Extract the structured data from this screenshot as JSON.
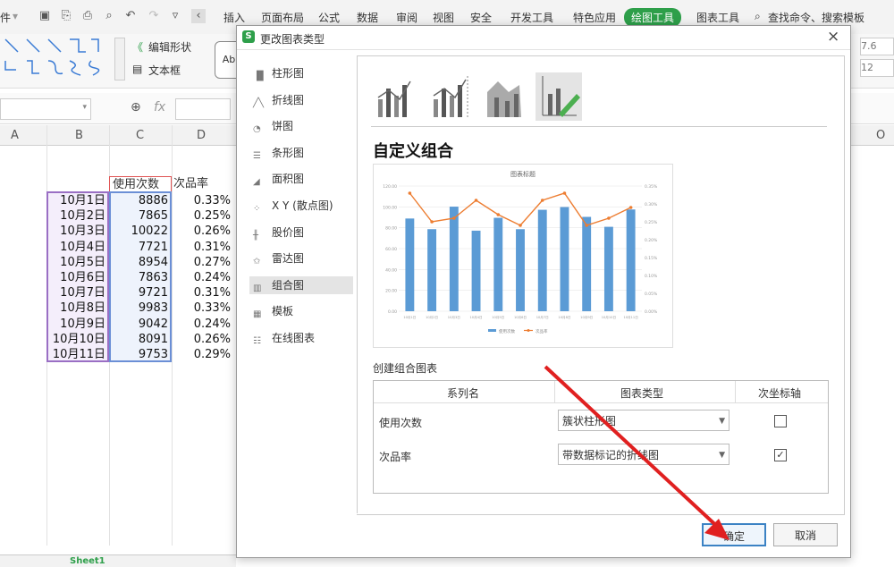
{
  "menu": {
    "file_partial": "件",
    "tabs": [
      "插入",
      "页面布局",
      "公式",
      "数据",
      "审阅",
      "视图",
      "安全",
      "开发工具",
      "特色应用"
    ],
    "active_tab": "绘图工具",
    "chart_tool_tab": "图表工具",
    "search_text": "查找命令、搜索模板"
  },
  "ribbon": {
    "edit_shape": "编辑形状",
    "text_box": "文本框",
    "style_preview": "Ab",
    "right_values": [
      "7.6",
      "12"
    ]
  },
  "formula": {
    "fx": "fx"
  },
  "sheet": {
    "columns": [
      "A",
      "B",
      "C",
      "D",
      "O"
    ],
    "header_c": "使用次数",
    "header_d": "次品率",
    "rows": [
      {
        "date": "10月1日",
        "count": "8886",
        "rate": "0.33%"
      },
      {
        "date": "10月2日",
        "count": "7865",
        "rate": "0.25%"
      },
      {
        "date": "10月3日",
        "count": "10022",
        "rate": "0.26%"
      },
      {
        "date": "10月4日",
        "count": "7721",
        "rate": "0.31%"
      },
      {
        "date": "10月5日",
        "count": "8954",
        "rate": "0.27%"
      },
      {
        "date": "10月6日",
        "count": "7863",
        "rate": "0.24%"
      },
      {
        "date": "10月7日",
        "count": "9721",
        "rate": "0.31%"
      },
      {
        "date": "10月8日",
        "count": "9983",
        "rate": "0.33%"
      },
      {
        "date": "10月9日",
        "count": "9042",
        "rate": "0.24%"
      },
      {
        "date": "10月10日",
        "count": "8091",
        "rate": "0.26%"
      },
      {
        "date": "10月11日",
        "count": "9753",
        "rate": "0.29%"
      }
    ],
    "sheet_tab": "Sheet1"
  },
  "dialog": {
    "title": "更改图表类型",
    "close": "×",
    "types": [
      "柱形图",
      "折线图",
      "饼图",
      "条形图",
      "面积图",
      "X Y (散点图)",
      "股价图",
      "雷达图",
      "组合图",
      "模板",
      "在线图表"
    ],
    "selected_type": "组合图",
    "heading": "自定义组合",
    "create_label": "创建组合图表",
    "col_series": "系列名",
    "col_type": "图表类型",
    "col_secondary": "次坐标轴",
    "rows": [
      {
        "series": "使用次数",
        "type": "簇状柱形图",
        "secondary": false
      },
      {
        "series": "次品率",
        "type": "带数据标记的折线图",
        "secondary": true
      }
    ],
    "ok": "确定",
    "cancel": "取消"
  },
  "chart_data": {
    "type": "bar",
    "title": "图表标题",
    "categories": [
      "10月1日",
      "10月2日",
      "10月3日",
      "10月4日",
      "10月5日",
      "10月6日",
      "10月7日",
      "10月8日",
      "10月9日",
      "10月10日",
      "10月11日"
    ],
    "series": [
      {
        "name": "使用次数",
        "type": "bar",
        "values": [
          8886,
          7865,
          10022,
          7721,
          8954,
          7863,
          9721,
          9983,
          9042,
          8091,
          9753
        ],
        "color": "#5b9bd5"
      },
      {
        "name": "次品率",
        "type": "line",
        "axis": "secondary",
        "values": [
          0.33,
          0.25,
          0.26,
          0.31,
          0.27,
          0.24,
          0.31,
          0.33,
          0.24,
          0.26,
          0.29
        ],
        "color": "#ed7d31"
      }
    ],
    "y_ticks": [
      "0.00",
      "20.00",
      "40.00",
      "60.00",
      "80.00",
      "100.00",
      "120.00"
    ],
    "y2_ticks": [
      "0.00%",
      "0.05%",
      "0.10%",
      "0.15%",
      "0.20%",
      "0.25%",
      "0.30%",
      "0.35%"
    ],
    "ylim": [
      0,
      12000
    ],
    "y2lim": [
      0,
      0.35
    ],
    "legend": "bottom"
  },
  "colors": {
    "accent_green": "#2e9f4a",
    "bar_blue": "#5b9bd5",
    "line_orange": "#ed7d31",
    "arrow_red": "#e02020"
  }
}
